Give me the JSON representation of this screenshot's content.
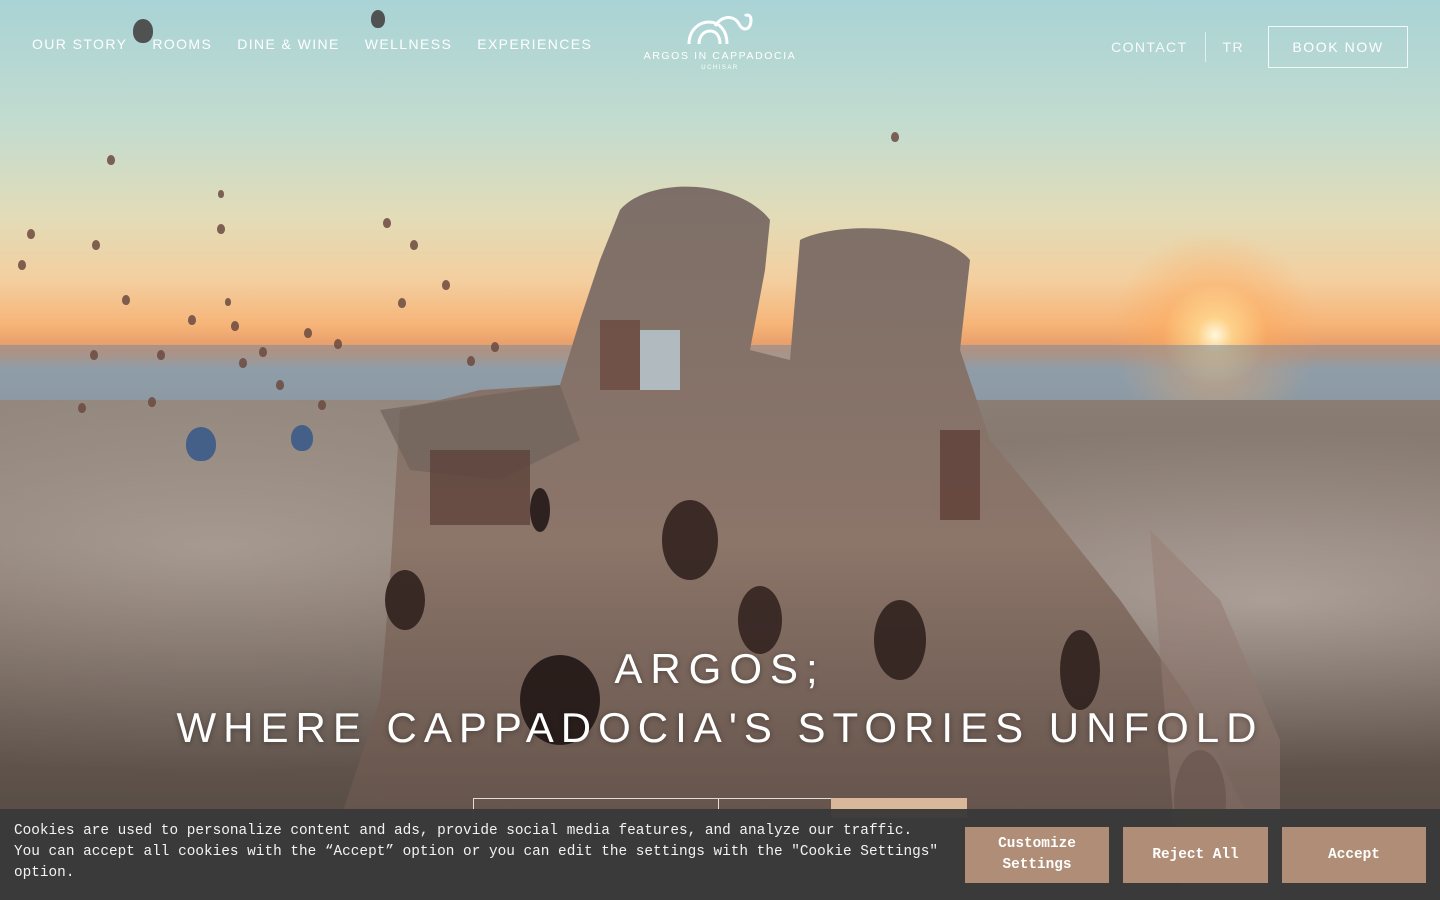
{
  "nav": {
    "items": [
      {
        "label": "OUR STORY"
      },
      {
        "label": "ROOMS"
      },
      {
        "label": "DINE & WINE"
      },
      {
        "label": "WELLNESS"
      },
      {
        "label": "EXPERIENCES"
      }
    ],
    "contact_label": "CONTACT",
    "language_label": "TR",
    "book_label": "BOOK NOW"
  },
  "logo": {
    "name": "ARGOS IN CAPPADOCIA",
    "subtitle": "UCHISAR",
    "icon": "argos-wave-logo-icon"
  },
  "hero": {
    "headline_line1": "ARGOS;",
    "headline_line2": "WHERE CAPPADOCIA'S STORIES UNFOLD"
  },
  "cookie_banner": {
    "message": "Cookies are used to personalize content and ads, provide social media features, and analyze our traffic. You can accept all cookies with the “Accept” option or you can edit the settings with the \"Cookie Settings\" option.",
    "customize_label": "Customize Settings",
    "reject_label": "Reject All",
    "accept_label": "Accept",
    "button_color": "#b08d76",
    "background_color": "#3a3a3a"
  },
  "colors": {
    "accent": "#b08d76",
    "booking_check_button": "#d9b79a"
  }
}
